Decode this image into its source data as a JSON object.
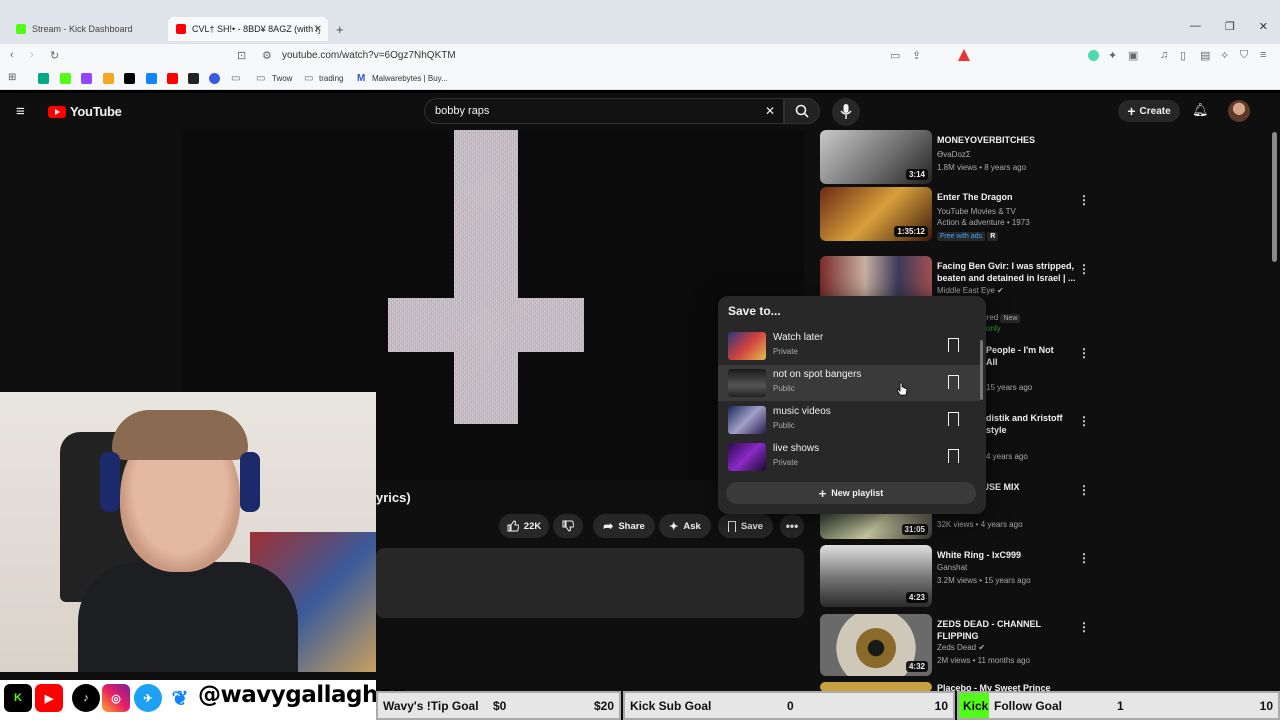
{
  "browser": {
    "tabs": [
      {
        "label": "Stream - Kick Dashboard"
      },
      {
        "label": "CVL† SH!• - 8BD¥ 8AGZ (with ly"
      }
    ],
    "url": "youtube.com/watch?v=6Ogz7NhQKTM",
    "bookmarks": [
      {
        "label": "Twow"
      },
      {
        "label": "trading"
      },
      {
        "label": "Malwarebytes | Buy..."
      }
    ]
  },
  "youtube": {
    "logo": "YouTube",
    "search_value": "bobby raps",
    "create_label": "Create"
  },
  "video": {
    "title_fragment": "yrics)",
    "likes": "22K",
    "share_label": "Share",
    "ask_label": "Ask",
    "save_label": "Save"
  },
  "save_dialog": {
    "title": "Save to...",
    "playlists": [
      {
        "name": "Watch later",
        "visibility": "Private"
      },
      {
        "name": "not on spot bangers",
        "visibility": "Public"
      },
      {
        "name": "music videos",
        "visibility": "Public"
      },
      {
        "name": "live shows",
        "visibility": "Private"
      }
    ],
    "new_playlist_label": "New playlist"
  },
  "related": [
    {
      "title": "MONEYOVERBITCHES",
      "channel": "ϴvaDozΣ",
      "meta": "1.8M views • 8 years ago",
      "duration": "3:14"
    },
    {
      "title": "Enter The Dragon",
      "channel": "YouTube Movies & TV",
      "meta": "Action & adventure • 1973",
      "badge": "Free with ads",
      "rating": "R",
      "duration": "1:35:12"
    },
    {
      "title": "Facing Ben Gvir: I was stripped, beaten and detained in Israel | ...",
      "channel": "Middle East Eye",
      "badge1": "tured",
      "badge2": "New",
      "extra": "only"
    },
    {
      "title": "People - I'm Not",
      "title2": "All",
      "meta": "15 years ago"
    },
    {
      "title": "distik and Kristoff",
      "title2": "style",
      "meta": "4 years ago"
    },
    {
      "title": "WITCH HOUSE MIX",
      "channel": "al",
      "meta": "32K views • 4 years ago",
      "duration": "31:05"
    },
    {
      "title": "White Ring - IxC999",
      "channel": "Ganshat",
      "meta": "3.2M views • 15 years ago",
      "duration": "4:23"
    },
    {
      "title": "ZEDS DEAD - CHANNEL FLIPPING",
      "channel": "Zeds Dead",
      "meta": "2M views • 11 months ago",
      "duration": "4:32"
    },
    {
      "title": "Placebo - My Sweet Prince"
    }
  ],
  "overlay": {
    "handle": "@wavygallagher",
    "goals": [
      {
        "label": "Wavy's !Tip Goal",
        "current": "$0",
        "target": "$20"
      },
      {
        "label": "Kick Sub Goal",
        "current": "0",
        "target": "10"
      },
      {
        "label_prefix": "Kick",
        "label": "Follow Goal",
        "current": "1",
        "target": "10"
      }
    ]
  },
  "colors": {
    "youtube_red": "#ff0000",
    "kick_green": "#53fc18",
    "background": "#0f0f0f"
  }
}
